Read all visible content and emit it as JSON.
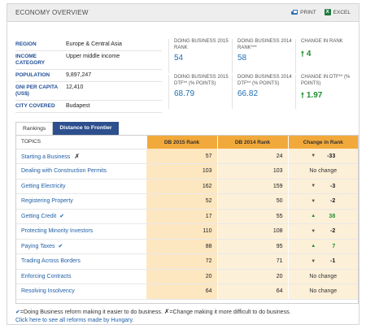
{
  "header": {
    "title": "ECONOMY OVERVIEW",
    "print_label": "PRINT",
    "excel_label": "EXCEL"
  },
  "summary": [
    {
      "label": "REGION",
      "value": "Europe & Central Asia"
    },
    {
      "label": "INCOME CATEGORY",
      "value": "Upper middle income"
    },
    {
      "label": "POPULATION",
      "value": "9,897,247"
    },
    {
      "label": "GNI PER CAPITA (US$)",
      "value": "12,410"
    },
    {
      "label": "CITY COVERED",
      "value": "Budapest"
    }
  ],
  "metrics": {
    "db2015_rank": {
      "label": "DOING BUSINESS 2015 RANK",
      "value": "54"
    },
    "db2014_rank": {
      "label": "DOING BUSINESS 2014 RANK***",
      "value": "58"
    },
    "change_rank": {
      "label": "CHANGE IN RANK",
      "value": "4"
    },
    "db2015_dtf": {
      "label": "DOING BUSINESS 2015 DTF** (% POINTS)",
      "value": "68.79"
    },
    "db2014_dtf": {
      "label": "DOING BUSINESS 2014 DTF** (% POINTS)",
      "value": "66.82"
    },
    "change_dtf": {
      "label": "CHANGE IN DTF** (% POINTS)",
      "value": "1.97"
    }
  },
  "tabs": {
    "rankings": "Rankings",
    "frontier": "Distance to Frontier"
  },
  "table": {
    "headers": {
      "topics": "TOPICS",
      "db2015": "DB 2015 Rank",
      "db2014": "DB 2014 Rank",
      "change": "Change in Rank"
    },
    "rows": [
      {
        "topic": "Starting a Business",
        "r15": "57",
        "r14": "24",
        "change": "-33",
        "dir": "down",
        "mark": "x"
      },
      {
        "topic": "Dealing with Construction Permits",
        "r15": "103",
        "r14": "103",
        "change": "No change",
        "dir": "none",
        "mark": ""
      },
      {
        "topic": "Getting Electricity",
        "r15": "162",
        "r14": "159",
        "change": "-3",
        "dir": "down",
        "mark": ""
      },
      {
        "topic": "Registering Property",
        "r15": "52",
        "r14": "50",
        "change": "-2",
        "dir": "down",
        "mark": ""
      },
      {
        "topic": "Getting Credit",
        "r15": "17",
        "r14": "55",
        "change": "38",
        "dir": "up",
        "mark": "check"
      },
      {
        "topic": "Protecting Minority Investors",
        "r15": "110",
        "r14": "108",
        "change": "-2",
        "dir": "down",
        "mark": ""
      },
      {
        "topic": "Paying Taxes",
        "r15": "88",
        "r14": "95",
        "change": "7",
        "dir": "up",
        "mark": "check"
      },
      {
        "topic": "Trading Across Borders",
        "r15": "72",
        "r14": "71",
        "change": "-1",
        "dir": "down",
        "mark": ""
      },
      {
        "topic": "Enforcing Contracts",
        "r15": "20",
        "r14": "20",
        "change": "No change",
        "dir": "none",
        "mark": ""
      },
      {
        "topic": "Resolving Insolvency",
        "r15": "64",
        "r14": "64",
        "change": "No change",
        "dir": "none",
        "mark": ""
      }
    ]
  },
  "footer": {
    "legend_check": "=Doing Business reform making it easier to do business.",
    "legend_x": "=Change making it more difficult to do business.",
    "link_text": "Click here to see all reforms made by Hungary."
  },
  "colors": {
    "accent_blue": "#2d4f8e",
    "header_orange": "#f2a93b",
    "green": "#1f8f2e"
  }
}
